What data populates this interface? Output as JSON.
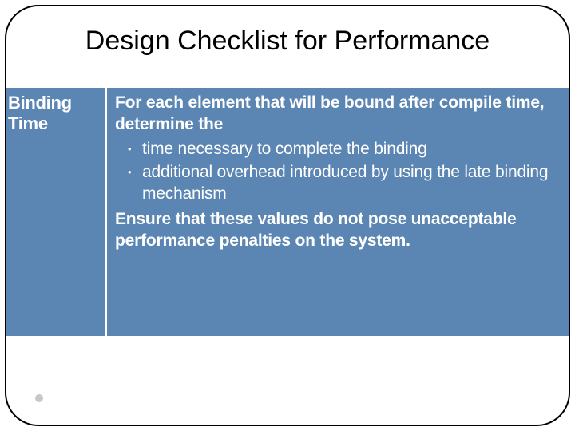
{
  "title": "Design Checklist for Performance",
  "row": {
    "label": "Binding Time",
    "intro": "For each element that will be bound after compile time, determine the",
    "bullets": [
      "time necessary to complete the binding",
      "additional overhead introduced by using the late binding mechanism"
    ],
    "conclusion": "Ensure that these values do not pose unacceptable performance penalties on the system."
  }
}
